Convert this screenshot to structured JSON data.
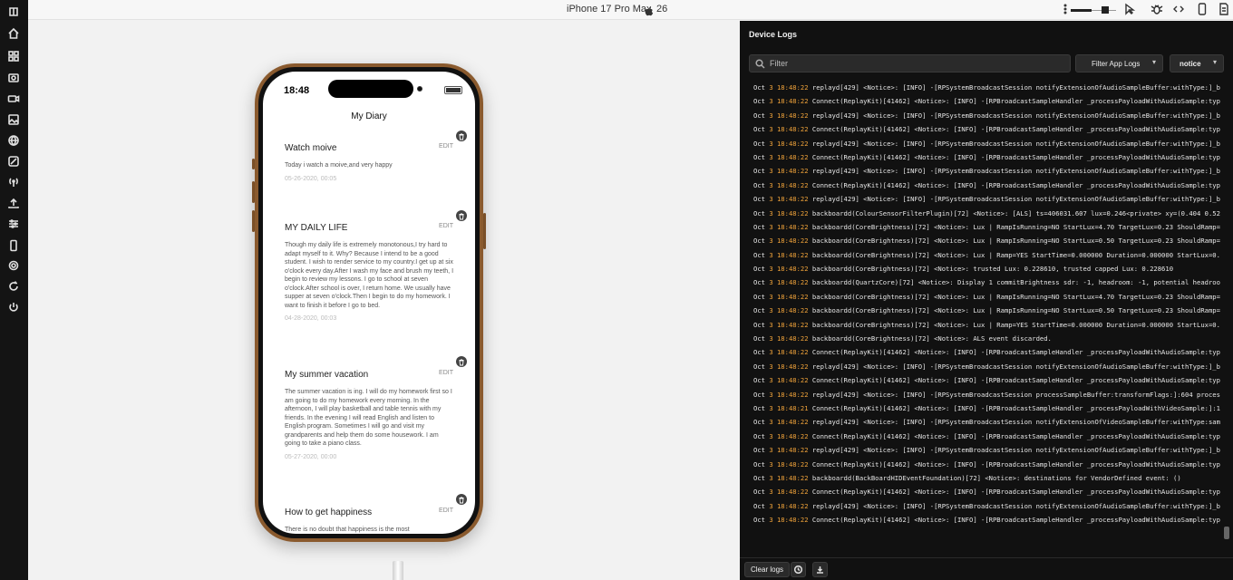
{
  "topbar": {
    "device_name": "iPhone 17 Pro Max",
    "ios_version": "26",
    "zoom_level": 0.45
  },
  "left_rail": {
    "icons": [
      "logo-icon",
      "home-icon",
      "grid-icon",
      "camera-icon",
      "video-icon",
      "image-icon",
      "globe-icon",
      "location-icon",
      "antenna-icon",
      "upload-icon",
      "sliders-icon",
      "phone-icon",
      "settings-icon",
      "refresh-icon",
      "power-icon"
    ]
  },
  "phone": {
    "time": "18:48",
    "app_title": "My Diary",
    "edit_label": "EDIT",
    "entries": [
      {
        "title": "Watch moive",
        "body": "Today i watch a moive,and very happy",
        "date": "05-26-2020, 00:05"
      },
      {
        "title": "MY DAILY LIFE",
        "body": "Though my daily life is extremely monotonous,I try hard to adapt myself to it. Why? Because I intend to be a good student. I wish to render service to my country.I get up at six o'clock every day.After I wash my face and brush my teeth, I begin to review my lessons. I go to school at seven o'clock.After school is over, I return home. We usually have supper at seven o'clock.Then I begin to do my homework. I want to finish it before I go to bed.",
        "date": "04-28-2020, 00:03"
      },
      {
        "title": "My summer vacation",
        "body": "The summer vacation is ing. I will do my homework first so I am going to do my homework every morning. In the afternoon, I will play basketball and table tennis with my friends. In the evening I will read English and listen to English program. Sometimes I will go and visit my grandparents and help them do some housework. I am going to take a piano class.",
        "date": "05-27-2020, 00:00"
      },
      {
        "title": "How to get happiness",
        "body": "There is no doubt that happiness is the most",
        "date": ""
      }
    ]
  },
  "logs": {
    "title": "Device Logs",
    "filter_placeholder": "Filter",
    "filter_app_logs": "Filter App Logs",
    "level": "notice",
    "clear_label": "Clear logs",
    "lines": [
      {
        "mo": "Oct",
        "ts": "3 18:48:22",
        "msg": "replayd[429] <Notice>:  [INFO] -[RPSystemBroadcastSession notifyExtensionOfAudioSampleBuffer:withType:]_blo"
      },
      {
        "mo": "Oct",
        "ts": "3 18:48:22",
        "msg": "Connect(ReplayKit)[41462] <Notice>:  [INFO] -[RPBroadcastSampleHandler _processPayloadWithAudioSample:type:"
      },
      {
        "mo": "Oct",
        "ts": "3 18:48:22",
        "msg": "replayd[429] <Notice>:  [INFO] -[RPSystemBroadcastSession notifyExtensionOfAudioSampleBuffer:withType:]_blo"
      },
      {
        "mo": "Oct",
        "ts": "3 18:48:22",
        "msg": "Connect(ReplayKit)[41462] <Notice>:  [INFO] -[RPBroadcastSampleHandler _processPayloadWithAudioSample:type:"
      },
      {
        "mo": "Oct",
        "ts": "3 18:48:22",
        "msg": "replayd[429] <Notice>:  [INFO] -[RPSystemBroadcastSession notifyExtensionOfAudioSampleBuffer:withType:]_blo"
      },
      {
        "mo": "Oct",
        "ts": "3 18:48:22",
        "msg": "Connect(ReplayKit)[41462] <Notice>:  [INFO] -[RPBroadcastSampleHandler _processPayloadWithAudioSample:type:"
      },
      {
        "mo": "Oct",
        "ts": "3 18:48:22",
        "msg": "replayd[429] <Notice>:  [INFO] -[RPSystemBroadcastSession notifyExtensionOfAudioSampleBuffer:withType:]_blo"
      },
      {
        "mo": "Oct",
        "ts": "3 18:48:22",
        "msg": "Connect(ReplayKit)[41462] <Notice>:  [INFO] -[RPBroadcastSampleHandler _processPayloadWithAudioSample:type:"
      },
      {
        "mo": "Oct",
        "ts": "3 18:48:22",
        "msg": "replayd[429] <Notice>:  [INFO] -[RPSystemBroadcastSession notifyExtensionOfAudioSampleBuffer:withType:]_blo"
      },
      {
        "mo": "Oct",
        "ts": "3 18:48:22",
        "msg": "backboardd(ColourSensorFilterPlugin)[72] <Notice>: [ALS] ts=406031.607 lux=0.246<private> xy=(0.404 0.527)"
      },
      {
        "mo": "Oct",
        "ts": "3 18:48:22",
        "msg": "backboardd(CoreBrightness)[72] <Notice>: Lux | RampIsRunning=NO StartLux=4.70 TargetLux=0.23 ShouldRamp=NO"
      },
      {
        "mo": "Oct",
        "ts": "3 18:48:22",
        "msg": "backboardd(CoreBrightness)[72] <Notice>: Lux | RampIsRunning=NO StartLux=0.50 TargetLux=0.23 ShouldRamp=YES"
      },
      {
        "mo": "Oct",
        "ts": "3 18:48:22",
        "msg": "backboardd(CoreBrightness)[72] <Notice>: Lux | Ramp=YES StartTime=0.000000 Duration=0.000000 StartLux=0.50"
      },
      {
        "mo": "Oct",
        "ts": "3 18:48:22",
        "msg": "backboardd(CoreBrightness)[72] <Notice>: trusted Lux: 0.228610, trusted capped Lux: 0.228610"
      },
      {
        "mo": "Oct",
        "ts": "3 18:48:22",
        "msg": "backboardd(QuartzCore)[72] <Notice>: Display 1 commitBrightness sdr: -1, headroom: -1, potential headroom:"
      },
      {
        "mo": "Oct",
        "ts": "3 18:48:22",
        "msg": "backboardd(CoreBrightness)[72] <Notice>: Lux | RampIsRunning=NO StartLux=4.70 TargetLux=0.23 ShouldRamp=NO"
      },
      {
        "mo": "Oct",
        "ts": "3 18:48:22",
        "msg": "backboardd(CoreBrightness)[72] <Notice>: Lux | RampIsRunning=NO StartLux=0.50 TargetLux=0.23 ShouldRamp=YES"
      },
      {
        "mo": "Oct",
        "ts": "3 18:48:22",
        "msg": "backboardd(CoreBrightness)[72] <Notice>: Lux | Ramp=YES StartTime=0.000000 Duration=0.000000 StartLux=0.50"
      },
      {
        "mo": "Oct",
        "ts": "3 18:48:22",
        "msg": "backboardd(CoreBrightness)[72] <Notice>: ALS event discarded."
      },
      {
        "mo": "Oct",
        "ts": "3 18:48:22",
        "msg": "Connect(ReplayKit)[41462] <Notice>:  [INFO] -[RPBroadcastSampleHandler _processPayloadWithAudioSample:type:"
      },
      {
        "mo": "Oct",
        "ts": "3 18:48:22",
        "msg": "replayd[429] <Notice>:  [INFO] -[RPSystemBroadcastSession notifyExtensionOfAudioSampleBuffer:withType:]_blo"
      },
      {
        "mo": "Oct",
        "ts": "3 18:48:22",
        "msg": "Connect(ReplayKit)[41462] <Notice>:  [INFO] -[RPBroadcastSampleHandler _processPayloadWithAudioSample:type:"
      },
      {
        "mo": "Oct",
        "ts": "3 18:48:22",
        "msg": "replayd[429] <Notice>:  [INFO] -[RPSystemBroadcastSession processSampleBuffer:transformFlags:]:604 process"
      },
      {
        "mo": "Oct",
        "ts": "3 18:48:21",
        "msg": "Connect(ReplayKit)[41462] <Notice>:  [INFO] -[RPBroadcastSampleHandler _processPayloadWithVideoSample:]:150"
      },
      {
        "mo": "Oct",
        "ts": "3 18:48:22",
        "msg": "replayd[429] <Notice>:  [INFO] -[RPSystemBroadcastSession notifyExtensionOfVideoSampleBuffer:withType:sampl"
      },
      {
        "mo": "Oct",
        "ts": "3 18:48:22",
        "msg": "Connect(ReplayKit)[41462] <Notice>:  [INFO] -[RPBroadcastSampleHandler _processPayloadWithAudioSample:type:"
      },
      {
        "mo": "Oct",
        "ts": "3 18:48:22",
        "msg": "replayd[429] <Notice>:  [INFO] -[RPSystemBroadcastSession notifyExtensionOfAudioSampleBuffer:withType:]_blo"
      },
      {
        "mo": "Oct",
        "ts": "3 18:48:22",
        "msg": "Connect(ReplayKit)[41462] <Notice>:  [INFO] -[RPBroadcastSampleHandler _processPayloadWithAudioSample:type:"
      },
      {
        "mo": "Oct",
        "ts": "3 18:48:22",
        "msg": "backboardd(BackBoardHIDEventFoundation)[72] <Notice>: destinations for VendorDefined event: ()"
      },
      {
        "mo": "Oct",
        "ts": "3 18:48:22",
        "msg": "Connect(ReplayKit)[41462] <Notice>:  [INFO] -[RPBroadcastSampleHandler _processPayloadWithAudioSample:type:"
      },
      {
        "mo": "Oct",
        "ts": "3 18:48:22",
        "msg": "replayd[429] <Notice>:  [INFO] -[RPSystemBroadcastSession notifyExtensionOfAudioSampleBuffer:withType:]_blo"
      },
      {
        "mo": "Oct",
        "ts": "3 18:48:22",
        "msg": "Connect(ReplayKit)[41462] <Notice>:  [INFO] -[RPBroadcastSampleHandler _processPayloadWithAudioSample:type:"
      }
    ]
  },
  "colors": {
    "timestamp": "#f0a33a",
    "log_bg": "#111111",
    "phone_frame": "#8a5a2e"
  }
}
